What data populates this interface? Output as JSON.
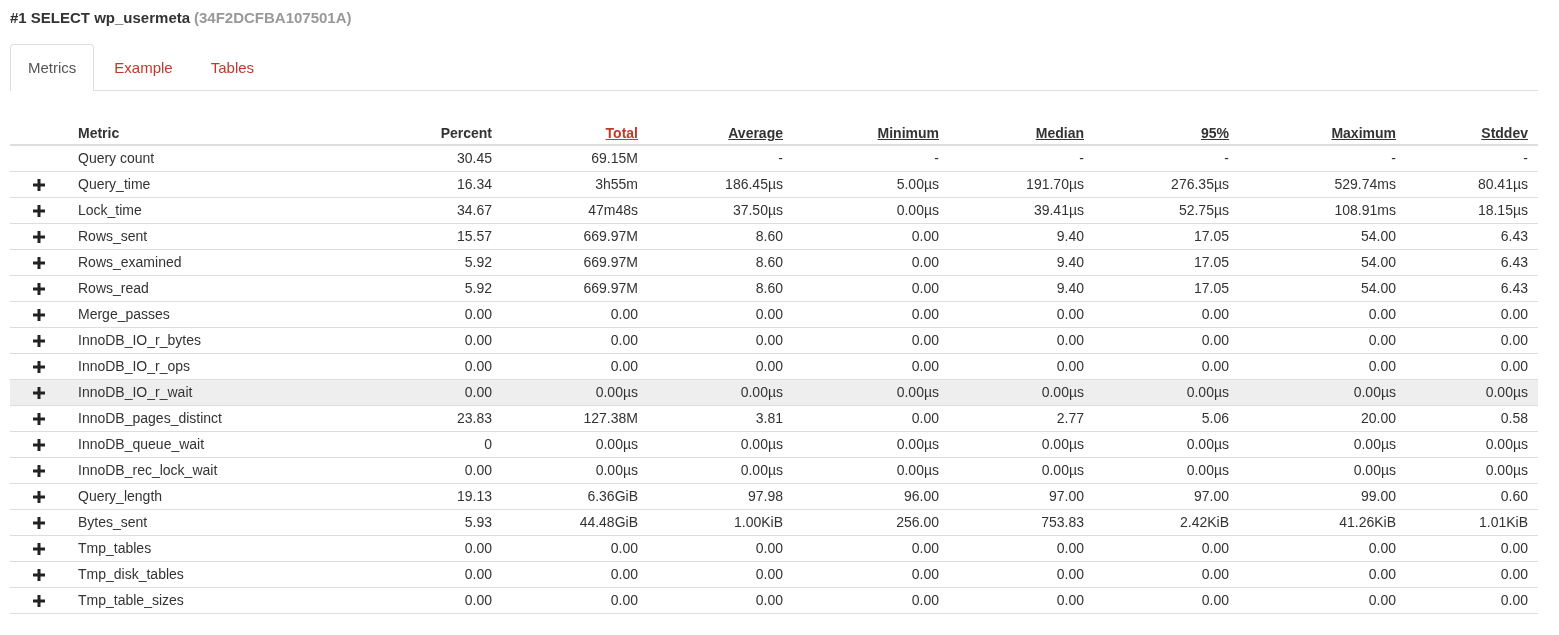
{
  "header": {
    "title": "#1 SELECT wp_usermeta",
    "checksum": "(34F2DCFBA107501A)"
  },
  "tabs": [
    {
      "label": "Metrics",
      "selected": true
    },
    {
      "label": "Example",
      "selected": false
    },
    {
      "label": "Tables",
      "selected": false
    }
  ],
  "table": {
    "columns": [
      {
        "label": "Metric",
        "kind": "plain",
        "selected": false
      },
      {
        "label": "Percent",
        "kind": "plain",
        "selected": false
      },
      {
        "label": "Total",
        "kind": "sortable",
        "selected": true
      },
      {
        "label": "Average",
        "kind": "sortable",
        "selected": false
      },
      {
        "label": "Minimum",
        "kind": "sortable",
        "selected": false
      },
      {
        "label": "Median",
        "kind": "sortable",
        "selected": false
      },
      {
        "label": "95%",
        "kind": "sortable",
        "selected": false
      },
      {
        "label": "Maximum",
        "kind": "sortable",
        "selected": false
      },
      {
        "label": "Stddev",
        "kind": "sortable",
        "selected": false
      }
    ],
    "rows": [
      {
        "expandable": false,
        "selected": false,
        "cells": [
          "Query count",
          "30.45",
          "69.15M",
          "-",
          "-",
          "-",
          "-",
          "-",
          "-"
        ]
      },
      {
        "expandable": true,
        "selected": false,
        "cells": [
          "Query_time",
          "16.34",
          "3h55m",
          "186.45µs",
          "5.00µs",
          "191.70µs",
          "276.35µs",
          "529.74ms",
          "80.41µs"
        ]
      },
      {
        "expandable": true,
        "selected": false,
        "cells": [
          "Lock_time",
          "34.67",
          "47m48s",
          "37.50µs",
          "0.00µs",
          "39.41µs",
          "52.75µs",
          "108.91ms",
          "18.15µs"
        ]
      },
      {
        "expandable": true,
        "selected": false,
        "cells": [
          "Rows_sent",
          "15.57",
          "669.97M",
          "8.60",
          "0.00",
          "9.40",
          "17.05",
          "54.00",
          "6.43"
        ]
      },
      {
        "expandable": true,
        "selected": false,
        "cells": [
          "Rows_examined",
          "5.92",
          "669.97M",
          "8.60",
          "0.00",
          "9.40",
          "17.05",
          "54.00",
          "6.43"
        ]
      },
      {
        "expandable": true,
        "selected": false,
        "cells": [
          "Rows_read",
          "5.92",
          "669.97M",
          "8.60",
          "0.00",
          "9.40",
          "17.05",
          "54.00",
          "6.43"
        ]
      },
      {
        "expandable": true,
        "selected": false,
        "cells": [
          "Merge_passes",
          "0.00",
          "0.00",
          "0.00",
          "0.00",
          "0.00",
          "0.00",
          "0.00",
          "0.00"
        ]
      },
      {
        "expandable": true,
        "selected": false,
        "cells": [
          "InnoDB_IO_r_bytes",
          "0.00",
          "0.00",
          "0.00",
          "0.00",
          "0.00",
          "0.00",
          "0.00",
          "0.00"
        ]
      },
      {
        "expandable": true,
        "selected": false,
        "cells": [
          "InnoDB_IO_r_ops",
          "0.00",
          "0.00",
          "0.00",
          "0.00",
          "0.00",
          "0.00",
          "0.00",
          "0.00"
        ]
      },
      {
        "expandable": true,
        "selected": true,
        "cells": [
          "InnoDB_IO_r_wait",
          "0.00",
          "0.00µs",
          "0.00µs",
          "0.00µs",
          "0.00µs",
          "0.00µs",
          "0.00µs",
          "0.00µs"
        ]
      },
      {
        "expandable": true,
        "selected": false,
        "cells": [
          "InnoDB_pages_distinct",
          "23.83",
          "127.38M",
          "3.81",
          "0.00",
          "2.77",
          "5.06",
          "20.00",
          "0.58"
        ]
      },
      {
        "expandable": true,
        "selected": false,
        "cells": [
          "InnoDB_queue_wait",
          "0",
          "0.00µs",
          "0.00µs",
          "0.00µs",
          "0.00µs",
          "0.00µs",
          "0.00µs",
          "0.00µs"
        ]
      },
      {
        "expandable": true,
        "selected": false,
        "cells": [
          "InnoDB_rec_lock_wait",
          "0.00",
          "0.00µs",
          "0.00µs",
          "0.00µs",
          "0.00µs",
          "0.00µs",
          "0.00µs",
          "0.00µs"
        ]
      },
      {
        "expandable": true,
        "selected": false,
        "cells": [
          "Query_length",
          "19.13",
          "6.36GiB",
          "97.98",
          "96.00",
          "97.00",
          "97.00",
          "99.00",
          "0.60"
        ]
      },
      {
        "expandable": true,
        "selected": false,
        "cells": [
          "Bytes_sent",
          "5.93",
          "44.48GiB",
          "1.00KiB",
          "256.00",
          "753.83",
          "2.42KiB",
          "41.26KiB",
          "1.01KiB"
        ]
      },
      {
        "expandable": true,
        "selected": false,
        "cells": [
          "Tmp_tables",
          "0.00",
          "0.00",
          "0.00",
          "0.00",
          "0.00",
          "0.00",
          "0.00",
          "0.00"
        ]
      },
      {
        "expandable": true,
        "selected": false,
        "cells": [
          "Tmp_disk_tables",
          "0.00",
          "0.00",
          "0.00",
          "0.00",
          "0.00",
          "0.00",
          "0.00",
          "0.00"
        ]
      },
      {
        "expandable": true,
        "selected": false,
        "cells": [
          "Tmp_table_sizes",
          "0.00",
          "0.00",
          "0.00",
          "0.00",
          "0.00",
          "0.00",
          "0.00",
          "0.00"
        ]
      }
    ]
  }
}
